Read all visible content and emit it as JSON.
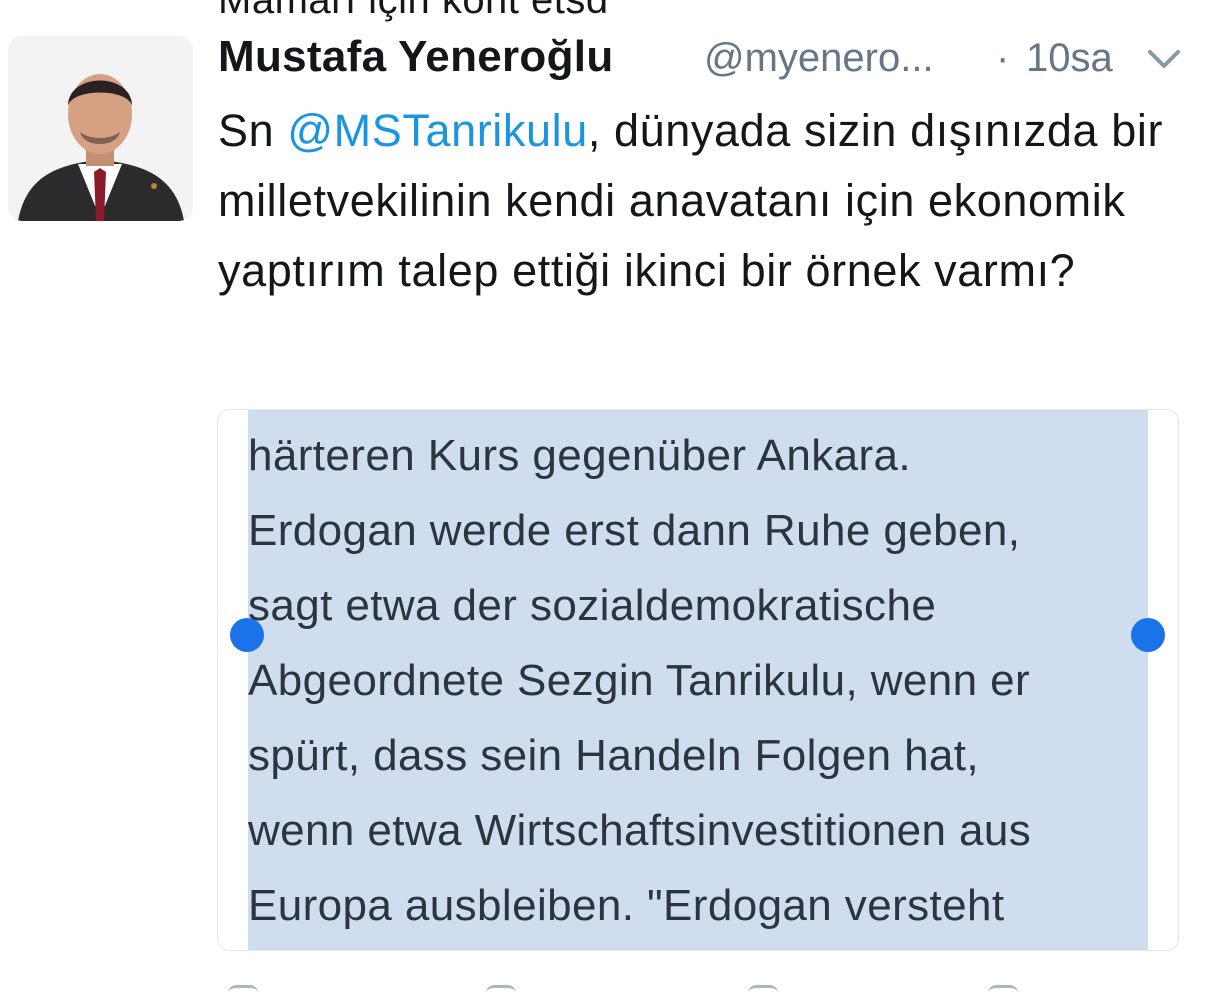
{
  "top_cut_text": "Mamarı için kont etsd",
  "tweet": {
    "author_name": "Mustafa Yeneroğlu",
    "author_handle": "@myenero...",
    "separator": "·",
    "timestamp": "10sa",
    "text_prefix": "Sn ",
    "mention": "@MSTanrikulu",
    "text_rest": ", dünyada sizin dışınızda bir milletvekilinin kendi anavatanı için ekonomik yaptırım talep ettiği ikinci bir örnek varmı?"
  },
  "media": {
    "lines": [
      "härteren Kurs gegenüber Ankara.",
      "Erdogan werde erst dann Ruhe geben,",
      "sagt etwa der sozialdemokratische",
      "Abgeordnete Sezgin Tanrikulu, wenn er",
      "spürt, dass sein Handeln Folgen hat,",
      "wenn etwa Wirtschaftsinvestitionen aus",
      "Europa ausbleiben. \"Erdogan versteht"
    ]
  },
  "icons": {
    "avatar": "profile-photo",
    "menu": "chevron-down-icon",
    "selection_handles": "text-selection-handle"
  },
  "colors": {
    "mention": "#1b95e0",
    "muted": "#657786",
    "selection": "#cfddef",
    "handle": "#1a73e8"
  }
}
